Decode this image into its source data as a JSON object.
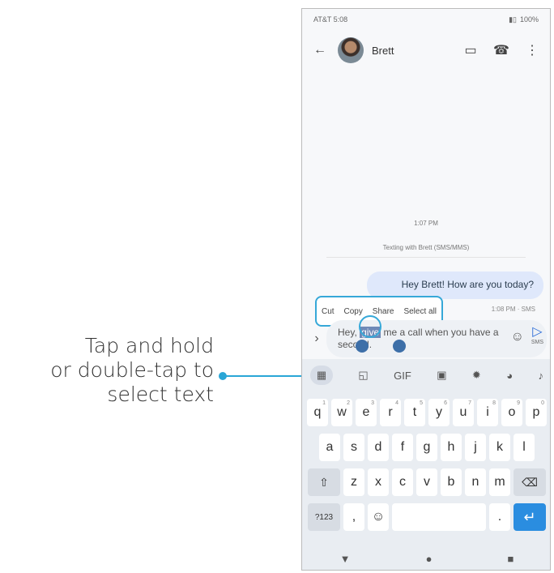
{
  "callout": {
    "lines": [
      "Tap and hold",
      "or double-tap to",
      "select text"
    ],
    "color": "#2aa6d6"
  },
  "status": {
    "carrier": "AT&T 5:08",
    "battery": "100%"
  },
  "conversation": {
    "contact": "Brett",
    "timestamp": "1:07 PM",
    "texting_with": "Texting with Brett (SMS/MMS)",
    "incoming": "Hey Brett! How are you today?",
    "meta": "1:08 PM · SMS"
  },
  "context_menu": [
    "Cut",
    "Copy",
    "Share",
    "Select all"
  ],
  "composer": {
    "before": "Hey, ",
    "selected": "give",
    "after": " me a call when you have a second.",
    "send_label": "SMS"
  },
  "keyboard": {
    "row1": [
      {
        "k": "q",
        "s": "1"
      },
      {
        "k": "w",
        "s": "2"
      },
      {
        "k": "e",
        "s": "3"
      },
      {
        "k": "r",
        "s": "4"
      },
      {
        "k": "t",
        "s": "5"
      },
      {
        "k": "y",
        "s": "6"
      },
      {
        "k": "u",
        "s": "7"
      },
      {
        "k": "i",
        "s": "8"
      },
      {
        "k": "o",
        "s": "9"
      },
      {
        "k": "p",
        "s": "0"
      }
    ],
    "row2": [
      "a",
      "s",
      "d",
      "f",
      "g",
      "h",
      "j",
      "k",
      "l"
    ],
    "row3": [
      "z",
      "x",
      "c",
      "v",
      "b",
      "n",
      "m"
    ],
    "num_label": "?123",
    "comma": ",",
    "period": "."
  },
  "accent_colors": {
    "callout": "#2aa6d6",
    "selection": "#6f89b7",
    "enter": "#2a8de0"
  }
}
